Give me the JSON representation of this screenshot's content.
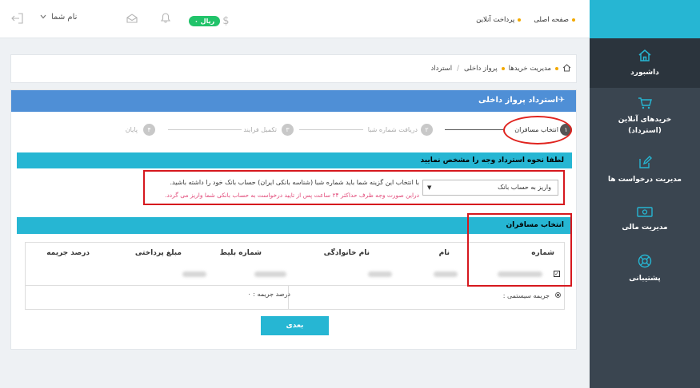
{
  "sidebar": {
    "items": [
      {
        "label": "داشبورد",
        "icon": "home-icon"
      },
      {
        "label": "خریدهای آنلاین",
        "sub": "(استرداد)",
        "icon": "cart-icon"
      },
      {
        "label": "مدیریت درخواست ها",
        "icon": "edit-icon"
      },
      {
        "label": "مدیریت مالی",
        "icon": "money-icon"
      },
      {
        "label": "پشتیبانی",
        "icon": "support-icon"
      }
    ]
  },
  "topbar": {
    "links": [
      "صفحه اصلی",
      "پرداخت آنلاین"
    ],
    "rial_badge": "ریال ۰",
    "username": "نام شما"
  },
  "breadcrumb": [
    "مدیریت خریدها",
    "پرواز داخلی",
    "استرداد"
  ],
  "panel": {
    "title": "استرداد پرواز داخلی",
    "steps": [
      {
        "num": "۱",
        "label": "انتخاب مسافران",
        "active": true
      },
      {
        "num": "۲",
        "label": "دریافت شماره شبا",
        "active": false
      },
      {
        "num": "۳",
        "label": "تکمیل فرایند",
        "active": false
      },
      {
        "num": "۴",
        "label": "پایان",
        "active": false
      }
    ],
    "refund_section_title": "لطفا نحوه استرداد وجه را مشخص نمایید",
    "refund_select_value": "واریز به حساب بانک",
    "refund_note": "با انتخاب این گزینه شما باید شماره شبا (شناسه بانکی ایران) حساب بانک خود را داشته باشید.",
    "refund_warning": "دراین صورت وجه ظرف حداکثر ۲۴ ساعت پس از تایید درخواست به حساب بانکی شما واریز می گردد.",
    "passengers_title": "انتخاب مسافران",
    "table_headers": [
      "شماره",
      "نام",
      "نام خانوادگی",
      "شماره بلیط",
      "مبلغ پرداختی",
      "درصد جریمه"
    ],
    "system_penalty_label": "جریمه سیستمی :",
    "penalty_percent_label": "درصد جریمه : ۰",
    "next_button": "بعدی"
  }
}
